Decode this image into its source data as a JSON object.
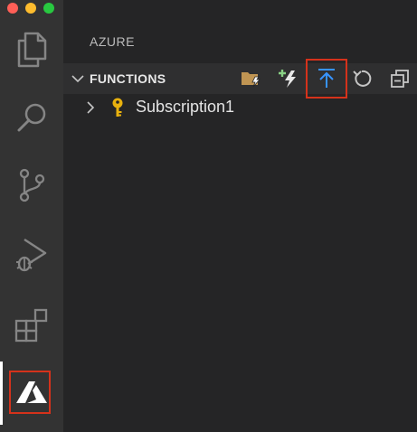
{
  "window": {
    "controls": [
      "close",
      "minimize",
      "maximize"
    ]
  },
  "activity_bar": {
    "items": [
      {
        "icon": "files-icon",
        "active": false
      },
      {
        "icon": "search-icon",
        "active": false
      },
      {
        "icon": "source-control-icon",
        "active": false
      },
      {
        "icon": "run-debug-icon",
        "active": false
      },
      {
        "icon": "extensions-icon",
        "active": false
      },
      {
        "icon": "azure-icon",
        "active": true
      }
    ]
  },
  "sidebar": {
    "title": "AZURE",
    "section": {
      "title": "FUNCTIONS",
      "expanded": true,
      "toolbar": [
        {
          "icon": "create-project-folder-icon"
        },
        {
          "icon": "create-function-lightning-icon"
        },
        {
          "icon": "deploy-upload-icon",
          "highlighted": true
        },
        {
          "icon": "refresh-icon"
        },
        {
          "icon": "collapse-all-icon"
        }
      ]
    },
    "tree": [
      {
        "label": "Subscription1",
        "icon": "key-icon",
        "expanded": false
      }
    ]
  },
  "colors": {
    "activity_bar_bg": "#333333",
    "sidebar_bg": "#252526",
    "section_header_bg": "#2f2f30",
    "highlight_border": "#d5321b",
    "accent_blue": "#3794ff",
    "key_yellow": "#e8b10e"
  }
}
